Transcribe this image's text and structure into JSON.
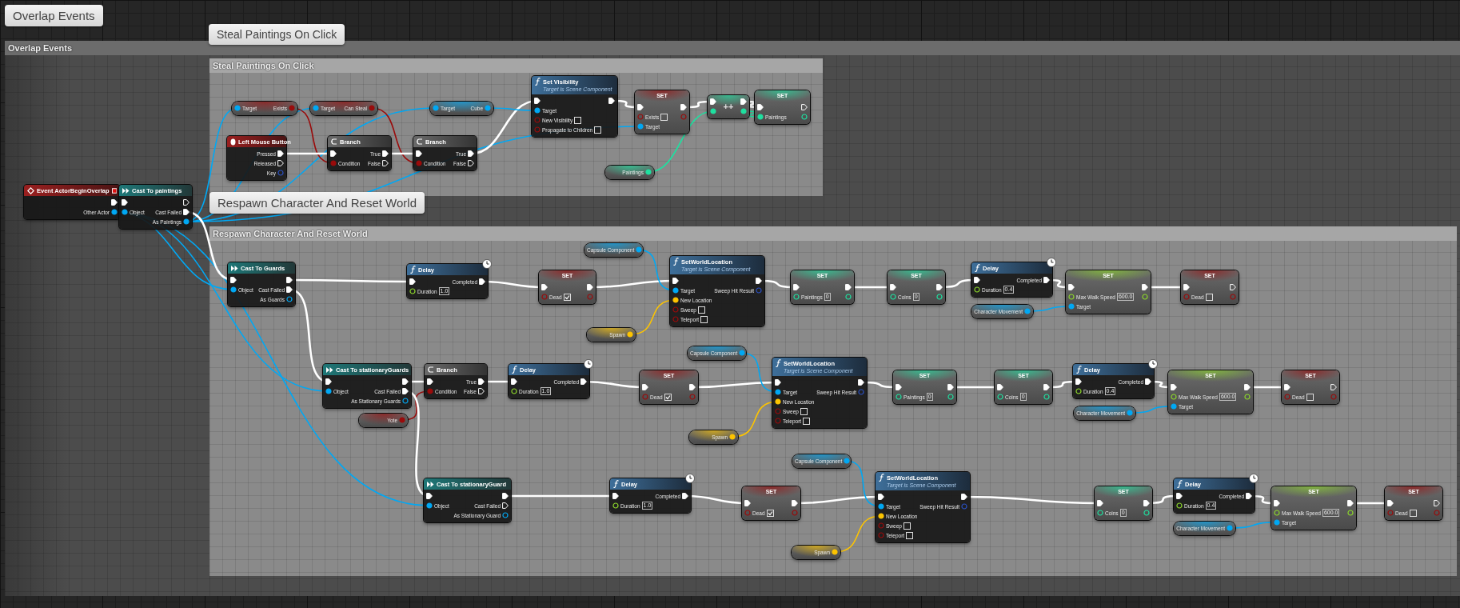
{
  "bubbles": [
    {
      "text": "Overlap Events"
    },
    {
      "text": "Steal Paintings On Click"
    },
    {
      "text": "Respawn Character And Reset World"
    }
  ],
  "comments": [
    {
      "title": "Overlap Events"
    },
    {
      "title": "Steal Paintings On Click"
    },
    {
      "title": "Respawn Character And Reset World"
    }
  ],
  "nodes": [
    {
      "kind": "event",
      "title": "Event ActorBeginOverlap",
      "outputs": [
        {
          "kind": "exec",
          "linked": true
        },
        {
          "label": "Other Actor",
          "kind": "object",
          "linked": true
        }
      ]
    },
    {
      "kind": "cast",
      "title": "Cast To paintings",
      "inputs": [
        {
          "kind": "exec",
          "linked": true
        },
        {
          "label": "Object",
          "kind": "object",
          "linked": true
        }
      ],
      "outputs": [
        {
          "kind": "exec",
          "linked": false
        },
        {
          "label": "Cast Failed",
          "kind": "exec",
          "linked": true
        },
        {
          "label": "As Paintings",
          "kind": "object",
          "linked": true
        }
      ]
    },
    {
      "kind": "getter",
      "inputs": [
        {
          "label": "Target",
          "kind": "object",
          "linked": true
        }
      ],
      "outputs": [
        {
          "label": "Exists",
          "kind": "bool",
          "linked": true
        }
      ]
    },
    {
      "kind": "getter",
      "inputs": [
        {
          "label": "Target",
          "kind": "object",
          "linked": true
        }
      ],
      "outputs": [
        {
          "label": "Can Steal",
          "kind": "bool",
          "linked": true
        }
      ]
    },
    {
      "kind": "getter",
      "inputs": [
        {
          "label": "Target",
          "kind": "object",
          "linked": true
        }
      ],
      "outputs": [
        {
          "label": "Cube",
          "kind": "object",
          "linked": true
        }
      ]
    },
    {
      "kind": "input",
      "title": "Left Mouse Button",
      "outputs": [
        {
          "label": "Pressed",
          "kind": "exec",
          "linked": true
        },
        {
          "label": "Released",
          "kind": "exec",
          "linked": false
        },
        {
          "label": "Key",
          "kind": "struct",
          "linked": false
        }
      ]
    },
    {
      "kind": "branch",
      "title": "Branch",
      "inputs": [
        {
          "kind": "exec",
          "linked": true
        },
        {
          "label": "Condition",
          "kind": "bool",
          "linked": true
        }
      ],
      "outputs": [
        {
          "label": "True",
          "kind": "exec",
          "linked": true
        },
        {
          "label": "False",
          "kind": "exec",
          "linked": false
        }
      ]
    },
    {
      "kind": "branch",
      "title": "Branch",
      "inputs": [
        {
          "kind": "exec",
          "linked": true
        },
        {
          "label": "Condition",
          "kind": "bool",
          "linked": true
        }
      ],
      "outputs": [
        {
          "label": "True",
          "kind": "exec",
          "linked": true
        },
        {
          "label": "False",
          "kind": "exec",
          "linked": false
        }
      ]
    },
    {
      "kind": "function",
      "title": "Set Visibility",
      "subtitle": "Target is Scene Component",
      "inputs": [
        {
          "kind": "exec",
          "linked": true
        },
        {
          "label": "Target",
          "kind": "object",
          "linked": true
        },
        {
          "label": "New Visibility",
          "kind": "bool",
          "linked": false,
          "checked": false
        },
        {
          "label": "Propagate to Children",
          "kind": "bool",
          "linked": false,
          "checked": false
        }
      ],
      "outputs": [
        {
          "kind": "exec",
          "linked": true
        }
      ]
    },
    {
      "kind": "set",
      "title": "SET",
      "inputs": [
        {
          "kind": "exec",
          "linked": true
        },
        {
          "label": "Exists",
          "kind": "bool",
          "linked": false,
          "checked": false
        },
        {
          "label": "Target",
          "kind": "object",
          "linked": true
        }
      ],
      "outputs": [
        {
          "kind": "exec",
          "linked": true
        },
        {
          "kind": "bool",
          "linked": false
        }
      ]
    },
    {
      "kind": "increment",
      "title": "++",
      "inputs": [
        {
          "kind": "exec",
          "linked": true
        },
        {
          "kind": "int",
          "linked": true
        }
      ],
      "outputs": [
        {
          "kind": "exec",
          "linked": true
        },
        {
          "kind": "int",
          "linked": true
        }
      ]
    },
    {
      "kind": "set",
      "title": "SET",
      "inputs": [
        {
          "kind": "exec",
          "linked": true
        },
        {
          "label": "Paintings",
          "kind": "int",
          "linked": true
        }
      ],
      "outputs": [
        {
          "kind": "exec",
          "linked": false
        },
        {
          "kind": "int",
          "linked": false
        }
      ]
    },
    {
      "kind": "getter",
      "outputs": [
        {
          "label": "Paintings",
          "kind": "int",
          "linked": true
        }
      ]
    },
    {
      "kind": "cast",
      "title": "Cast To Guards",
      "inputs": [
        {
          "kind": "exec",
          "linked": true
        },
        {
          "label": "Object",
          "kind": "object",
          "linked": true
        }
      ],
      "outputs": [
        {
          "kind": "exec",
          "linked": true
        },
        {
          "label": "Cast Failed",
          "kind": "exec",
          "linked": true
        },
        {
          "label": "As Guards",
          "kind": "object",
          "linked": false
        }
      ]
    },
    {
      "kind": "function",
      "title": "Delay",
      "latent": true,
      "inputs": [
        {
          "kind": "exec",
          "linked": true
        },
        {
          "label": "Duration",
          "kind": "float",
          "linked": false,
          "value": "1.0"
        }
      ],
      "outputs": [
        {
          "label": "Completed",
          "kind": "exec",
          "linked": true
        }
      ]
    },
    {
      "kind": "set",
      "title": "SET",
      "inputs": [
        {
          "kind": "exec",
          "linked": true
        },
        {
          "label": "Dead",
          "kind": "bool",
          "linked": false,
          "checked": true
        }
      ],
      "outputs": [
        {
          "kind": "exec",
          "linked": true
        },
        {
          "kind": "bool",
          "linked": false
        }
      ]
    },
    {
      "kind": "getter",
      "outputs": [
        {
          "label": "Capsule Component",
          "kind": "object",
          "linked": true
        }
      ]
    },
    {
      "kind": "getter",
      "outputs": [
        {
          "label": "Spawn",
          "kind": "vector",
          "linked": true
        }
      ]
    },
    {
      "kind": "function",
      "title": "SetWorldLocation",
      "subtitle": "Target is Scene Component",
      "inputs": [
        {
          "kind": "exec",
          "linked": true
        },
        {
          "label": "Target",
          "kind": "object",
          "linked": true
        },
        {
          "label": "New Location",
          "kind": "vector",
          "linked": true
        },
        {
          "label": "Sweep",
          "kind": "bool",
          "linked": false,
          "checked": false
        },
        {
          "label": "Teleport",
          "kind": "bool",
          "linked": false,
          "checked": false
        }
      ],
      "outputs": [
        {
          "kind": "exec",
          "linked": true
        },
        {
          "label": "Sweep Hit Result",
          "kind": "struct",
          "linked": false
        }
      ]
    },
    {
      "kind": "set",
      "title": "SET",
      "inputs": [
        {
          "kind": "exec",
          "linked": true
        },
        {
          "label": "Paintings",
          "kind": "int",
          "linked": false,
          "value": "0"
        }
      ],
      "outputs": [
        {
          "kind": "exec",
          "linked": true
        },
        {
          "kind": "int",
          "linked": false
        }
      ]
    },
    {
      "kind": "set",
      "title": "SET",
      "inputs": [
        {
          "kind": "exec",
          "linked": true
        },
        {
          "label": "Coins",
          "kind": "int",
          "linked": false,
          "value": "0"
        }
      ],
      "outputs": [
        {
          "kind": "exec",
          "linked": true
        },
        {
          "kind": "int",
          "linked": false
        }
      ]
    },
    {
      "kind": "function",
      "title": "Delay",
      "latent": true,
      "inputs": [
        {
          "kind": "exec",
          "linked": true
        },
        {
          "label": "Duration",
          "kind": "float",
          "linked": false,
          "value": "0.4"
        }
      ],
      "outputs": [
        {
          "label": "Completed",
          "kind": "exec",
          "linked": true
        }
      ]
    },
    {
      "kind": "getter",
      "outputs": [
        {
          "label": "Character Movement",
          "kind": "object",
          "linked": true
        }
      ]
    },
    {
      "kind": "set",
      "title": "SET",
      "inputs": [
        {
          "kind": "exec",
          "linked": true
        },
        {
          "label": "Max Walk Speed",
          "kind": "float",
          "linked": false,
          "value": "600.0"
        },
        {
          "label": "Target",
          "kind": "object",
          "linked": true
        }
      ],
      "outputs": [
        {
          "kind": "exec",
          "linked": true
        },
        {
          "kind": "float",
          "linked": false
        }
      ]
    },
    {
      "kind": "set",
      "title": "SET",
      "inputs": [
        {
          "kind": "exec",
          "linked": true
        },
        {
          "label": "Dead",
          "kind": "bool",
          "linked": false,
          "checked": false
        }
      ],
      "outputs": [
        {
          "kind": "exec",
          "linked": false
        },
        {
          "kind": "bool",
          "linked": false
        }
      ]
    },
    {
      "kind": "cast",
      "title": "Cast To stationaryGuards",
      "inputs": [
        {
          "kind": "exec",
          "linked": true
        },
        {
          "label": "Object",
          "kind": "object",
          "linked": true
        }
      ],
      "outputs": [
        {
          "kind": "exec",
          "linked": true
        },
        {
          "label": "Cast Failed",
          "kind": "exec",
          "linked": true
        },
        {
          "label": "As Stationary Guards",
          "kind": "object",
          "linked": false
        }
      ]
    },
    {
      "kind": "branch",
      "title": "Branch",
      "inputs": [
        {
          "kind": "exec",
          "linked": true
        },
        {
          "label": "Condition",
          "kind": "bool",
          "linked": true
        }
      ],
      "outputs": [
        {
          "label": "True",
          "kind": "exec",
          "linked": true
        },
        {
          "label": "False",
          "kind": "exec",
          "linked": false
        }
      ]
    },
    {
      "kind": "getter",
      "outputs": [
        {
          "label": "Yote",
          "kind": "bool",
          "linked": true
        }
      ]
    },
    {
      "kind": "function",
      "title": "Delay",
      "latent": true,
      "inputs": [
        {
          "kind": "exec",
          "linked": true
        },
        {
          "label": "Duration",
          "kind": "float",
          "linked": false,
          "value": "1.0"
        }
      ],
      "outputs": [
        {
          "label": "Completed",
          "kind": "exec",
          "linked": true
        }
      ]
    },
    {
      "kind": "set",
      "title": "SET",
      "inputs": [
        {
          "kind": "exec",
          "linked": true
        },
        {
          "label": "Dead",
          "kind": "bool",
          "linked": false,
          "checked": true
        }
      ],
      "outputs": [
        {
          "kind": "exec",
          "linked": true
        },
        {
          "kind": "bool",
          "linked": false
        }
      ]
    },
    {
      "kind": "getter",
      "outputs": [
        {
          "label": "Capsule Component",
          "kind": "object",
          "linked": true
        }
      ]
    },
    {
      "kind": "function",
      "title": "SetWorldLocation",
      "subtitle": "Target is Scene Component",
      "inputs": [
        {
          "kind": "exec",
          "linked": true
        },
        {
          "label": "Target",
          "kind": "object",
          "linked": true
        },
        {
          "label": "New Location",
          "kind": "vector",
          "linked": true
        },
        {
          "label": "Sweep",
          "kind": "bool",
          "linked": false,
          "checked": false
        },
        {
          "label": "Teleport",
          "kind": "bool",
          "linked": false,
          "checked": false
        }
      ],
      "outputs": [
        {
          "kind": "exec",
          "linked": true
        },
        {
          "label": "Sweep Hit Result",
          "kind": "struct",
          "linked": false
        }
      ]
    },
    {
      "kind": "getter",
      "outputs": [
        {
          "label": "Spawn",
          "kind": "vector",
          "linked": true
        }
      ]
    },
    {
      "kind": "set",
      "title": "SET",
      "inputs": [
        {
          "kind": "exec",
          "linked": true
        },
        {
          "label": "Paintings",
          "kind": "int",
          "linked": false,
          "value": "0"
        }
      ],
      "outputs": [
        {
          "kind": "exec",
          "linked": true
        },
        {
          "kind": "int",
          "linked": false
        }
      ]
    },
    {
      "kind": "set",
      "title": "SET",
      "inputs": [
        {
          "kind": "exec",
          "linked": true
        },
        {
          "label": "Coins",
          "kind": "int",
          "linked": false,
          "value": "0"
        }
      ],
      "outputs": [
        {
          "kind": "exec",
          "linked": true
        },
        {
          "kind": "int",
          "linked": false
        }
      ]
    },
    {
      "kind": "function",
      "title": "Delay",
      "latent": true,
      "inputs": [
        {
          "kind": "exec",
          "linked": true
        },
        {
          "label": "Duration",
          "kind": "float",
          "linked": false,
          "value": "0.4"
        }
      ],
      "outputs": [
        {
          "label": "Completed",
          "kind": "exec",
          "linked": true
        }
      ]
    },
    {
      "kind": "getter",
      "outputs": [
        {
          "label": "Character Movement",
          "kind": "object",
          "linked": true
        }
      ]
    },
    {
      "kind": "set",
      "title": "SET",
      "inputs": [
        {
          "kind": "exec",
          "linked": true
        },
        {
          "label": "Max Walk Speed",
          "kind": "float",
          "linked": false,
          "value": "600.0"
        },
        {
          "label": "Target",
          "kind": "object",
          "linked": true
        }
      ],
      "outputs": [
        {
          "kind": "exec",
          "linked": true
        },
        {
          "kind": "float",
          "linked": false
        }
      ]
    },
    {
      "kind": "set",
      "title": "SET",
      "inputs": [
        {
          "kind": "exec",
          "linked": true
        },
        {
          "label": "Dead",
          "kind": "bool",
          "linked": false,
          "checked": false
        }
      ],
      "outputs": [
        {
          "kind": "exec",
          "linked": false
        },
        {
          "kind": "bool",
          "linked": false
        }
      ]
    },
    {
      "kind": "cast",
      "title": "Cast To stationaryGuard",
      "inputs": [
        {
          "kind": "exec",
          "linked": true
        },
        {
          "label": "Object",
          "kind": "object",
          "linked": true
        }
      ],
      "outputs": [
        {
          "kind": "exec",
          "linked": true
        },
        {
          "label": "Cast Failed",
          "kind": "exec",
          "linked": false
        },
        {
          "label": "As Stationary Guard",
          "kind": "object",
          "linked": false
        }
      ]
    },
    {
      "kind": "function",
      "title": "Delay",
      "latent": true,
      "inputs": [
        {
          "kind": "exec",
          "linked": true
        },
        {
          "label": "Duration",
          "kind": "float",
          "linked": false,
          "value": "1.0"
        }
      ],
      "outputs": [
        {
          "label": "Completed",
          "kind": "exec",
          "linked": true
        }
      ]
    },
    {
      "kind": "set",
      "title": "SET",
      "inputs": [
        {
          "kind": "exec",
          "linked": true
        },
        {
          "label": "Dead",
          "kind": "bool",
          "linked": false,
          "checked": true
        }
      ],
      "outputs": [
        {
          "kind": "exec",
          "linked": true
        },
        {
          "kind": "bool",
          "linked": false
        }
      ]
    },
    {
      "kind": "getter",
      "outputs": [
        {
          "label": "Capsule Component",
          "kind": "object",
          "linked": true
        }
      ]
    },
    {
      "kind": "function",
      "title": "SetWorldLocation",
      "subtitle": "Target is Scene Component",
      "inputs": [
        {
          "kind": "exec",
          "linked": true
        },
        {
          "label": "Target",
          "kind": "object",
          "linked": true
        },
        {
          "label": "New Location",
          "kind": "vector",
          "linked": true
        },
        {
          "label": "Sweep",
          "kind": "bool",
          "linked": false,
          "checked": false
        },
        {
          "label": "Teleport",
          "kind": "bool",
          "linked": false,
          "checked": false
        }
      ],
      "outputs": [
        {
          "kind": "exec",
          "linked": true
        },
        {
          "label": "Sweep Hit Result",
          "kind": "struct",
          "linked": false
        }
      ]
    },
    {
      "kind": "getter",
      "outputs": [
        {
          "label": "Spawn",
          "kind": "vector",
          "linked": true
        }
      ]
    },
    {
      "kind": "set",
      "title": "SET",
      "inputs": [
        {
          "kind": "exec",
          "linked": true
        },
        {
          "label": "Coins",
          "kind": "int",
          "linked": false,
          "value": "0"
        }
      ],
      "outputs": [
        {
          "kind": "exec",
          "linked": true
        },
        {
          "kind": "int",
          "linked": false
        }
      ]
    },
    {
      "kind": "function",
      "title": "Delay",
      "latent": true,
      "inputs": [
        {
          "kind": "exec",
          "linked": true
        },
        {
          "label": "Duration",
          "kind": "float",
          "linked": false,
          "value": "0.4"
        }
      ],
      "outputs": [
        {
          "label": "Completed",
          "kind": "exec",
          "linked": true
        }
      ]
    },
    {
      "kind": "getter",
      "outputs": [
        {
          "label": "Character Movement",
          "kind": "object",
          "linked": true
        }
      ]
    },
    {
      "kind": "set",
      "title": "SET",
      "inputs": [
        {
          "kind": "exec",
          "linked": true
        },
        {
          "label": "Max Walk Speed",
          "kind": "float",
          "linked": false,
          "value": "600.0"
        },
        {
          "label": "Target",
          "kind": "object",
          "linked": true
        }
      ],
      "outputs": [
        {
          "kind": "exec",
          "linked": true
        },
        {
          "kind": "float",
          "linked": false
        }
      ]
    },
    {
      "kind": "set",
      "title": "SET",
      "inputs": [
        {
          "kind": "exec",
          "linked": true
        },
        {
          "label": "Dead",
          "kind": "bool",
          "linked": false,
          "checked": false
        }
      ],
      "outputs": [
        {
          "kind": "exec",
          "linked": false
        },
        {
          "kind": "bool",
          "linked": false
        }
      ]
    }
  ]
}
